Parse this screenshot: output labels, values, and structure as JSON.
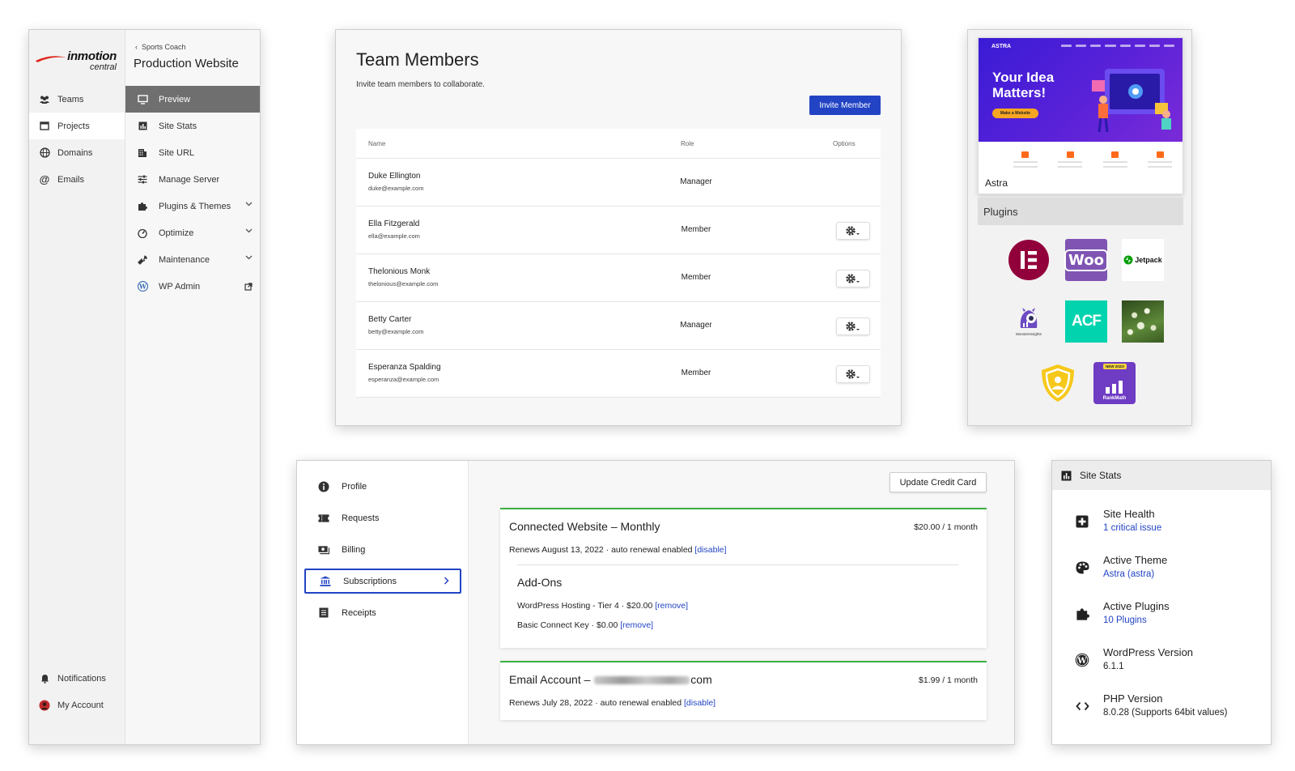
{
  "nav": {
    "logo": {
      "brand": "inmotion",
      "sub": "central"
    },
    "primary": [
      {
        "label": "Teams",
        "icon": "people-icon"
      },
      {
        "label": "Projects",
        "icon": "window-icon",
        "active": true
      },
      {
        "label": "Domains",
        "icon": "globe-icon"
      },
      {
        "label": "Emails",
        "icon": "at-icon"
      }
    ],
    "bottom": [
      {
        "label": "Notifications",
        "icon": "bell-icon"
      },
      {
        "label": "My Account",
        "icon": "avatar"
      }
    ],
    "breadcrumb": "Sports Coach",
    "site_title": "Production Website",
    "secondary": [
      {
        "label": "Preview",
        "icon": "monitor-icon",
        "active": true
      },
      {
        "label": "Site Stats",
        "icon": "bar-chart-icon"
      },
      {
        "label": "Site URL",
        "icon": "building-icon"
      },
      {
        "label": "Manage Server",
        "icon": "sliders-icon"
      },
      {
        "label": "Plugins & Themes",
        "icon": "puzzle-icon",
        "expandable": true
      },
      {
        "label": "Optimize",
        "icon": "speedometer-icon",
        "expandable": true
      },
      {
        "label": "Maintenance",
        "icon": "wrench-icon",
        "expandable": true
      },
      {
        "label": "WP Admin",
        "icon": "wordpress-icon",
        "external": true
      }
    ]
  },
  "team": {
    "title": "Team Members",
    "subtitle": "Invite team members to collaborate.",
    "invite_button": "Invite Member",
    "columns": {
      "name": "Name",
      "role": "Role",
      "options": "Options"
    },
    "members": [
      {
        "name": "Duke Ellington",
        "email": "duke@example.com",
        "role": "Manager",
        "has_options": false
      },
      {
        "name": "Ella Fitzgerald",
        "email": "ella@example.com",
        "role": "Member",
        "has_options": true
      },
      {
        "name": "Thelonious Monk",
        "email": "thelonious@example.com",
        "role": "Member",
        "has_options": true
      },
      {
        "name": "Betty Carter",
        "email": "betty@example.com",
        "role": "Manager",
        "has_options": true
      },
      {
        "name": "Esperanza Spalding",
        "email": "esperanza@example.com",
        "role": "Member",
        "has_options": true
      }
    ]
  },
  "theme": {
    "preview": {
      "logo": "ASTRA",
      "headline": "Your Idea Matters!",
      "cta": "Make a Website"
    },
    "name": "Astra"
  },
  "plugins": {
    "title": "Plugins",
    "items": [
      {
        "name": "Elementor",
        "icon": "elementor-icon",
        "color": "#92003b"
      },
      {
        "name": "WooCommerce",
        "icon": "woo-icon",
        "label": "Woo",
        "color": "#7f54b3"
      },
      {
        "name": "Jetpack",
        "icon": "jetpack-icon",
        "label": "Jetpack",
        "color": "#069e08"
      },
      {
        "name": "MonsterInsights",
        "icon": "monsterinsights-icon",
        "label": "MonsterInsights",
        "color": "#6c4bc2"
      },
      {
        "name": "ACF",
        "icon": "acf-icon",
        "label": "ACF",
        "color": "#00d3ae"
      },
      {
        "name": "Flowers",
        "icon": "flowers-photo-icon",
        "color": "#3f6b2a"
      },
      {
        "name": "Shield",
        "icon": "shield-icon",
        "color": "#f6c81a"
      },
      {
        "name": "RankMath",
        "icon": "rankmath-icon",
        "label": "RankMath",
        "badge": "NEW 2022!",
        "color": "#6f3cc4"
      }
    ]
  },
  "account": {
    "menu": [
      {
        "label": "Profile",
        "icon": "info-icon"
      },
      {
        "label": "Requests",
        "icon": "ticket-icon"
      },
      {
        "label": "Billing",
        "icon": "money-icon"
      },
      {
        "label": "Subscriptions",
        "icon": "bank-icon",
        "active": true
      },
      {
        "label": "Receipts",
        "icon": "receipt-icon"
      }
    ],
    "update_card_button": "Update Credit Card",
    "subscriptions": [
      {
        "title": "Connected Website – Monthly",
        "price": "$20.00 / 1 month",
        "renews": "Renews August 13, 2022 · auto renewal enabled",
        "action": "[disable]",
        "addons_title": "Add-Ons",
        "addons": [
          {
            "text": "WordPress Hosting - Tier 4 · $20.00",
            "action": "[remove]"
          },
          {
            "text": "Basic Connect Key · $0.00",
            "action": "[remove]"
          }
        ]
      },
      {
        "title_prefix": "Email Account –",
        "title_suffix": "com",
        "price": "$1.99 / 1 month",
        "renews": "Renews July 28, 2022 · auto renewal enabled",
        "action": "[disable]"
      }
    ]
  },
  "stats": {
    "title": "Site Stats",
    "items": [
      {
        "label": "Site Health",
        "value": "1 critical issue",
        "is_link": true,
        "icon": "medical-plus-icon"
      },
      {
        "label": "Active Theme",
        "value": "Astra (astra)",
        "is_link": true,
        "icon": "palette-icon"
      },
      {
        "label": "Active Plugins",
        "value": "10 Plugins",
        "is_link": true,
        "icon": "puzzle-icon"
      },
      {
        "label": "WordPress Version",
        "value": "6.1.1",
        "is_link": false,
        "icon": "wordpress-icon"
      },
      {
        "label": "PHP Version",
        "value": "8.0.28 (Supports 64bit values)",
        "is_link": false,
        "icon": "code-icon"
      }
    ]
  },
  "colors": {
    "accent": "#2244c4",
    "success": "#3cb043",
    "nav_active": "#6f6f6f"
  }
}
